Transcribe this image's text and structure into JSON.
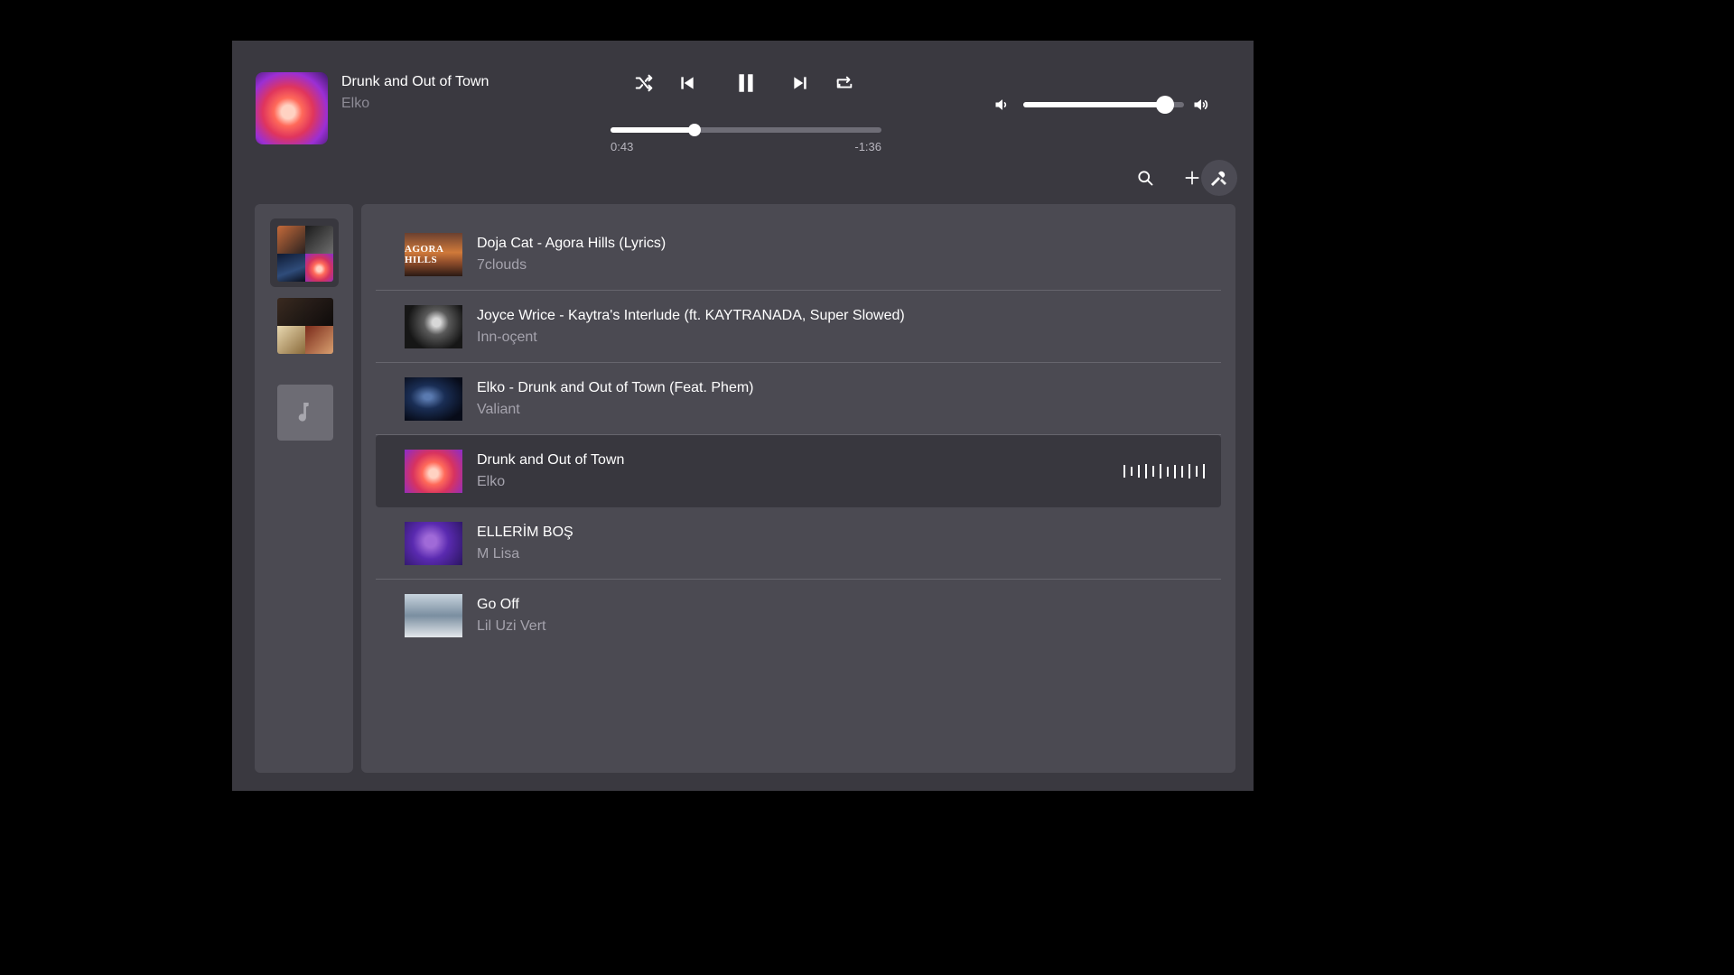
{
  "now_playing": {
    "title": "Drunk and Out of Town",
    "artist": "Elko",
    "elapsed": "0:43",
    "remaining": "-1:36",
    "progress": 0.31,
    "is_playing": true
  },
  "volume": {
    "level": 0.88
  },
  "controls": [
    "shuffle-icon",
    "previous-icon",
    "pause-icon",
    "next-icon",
    "repeat-icon"
  ],
  "toolbar": [
    "search-icon",
    "plus-icon",
    "tools-icon"
  ],
  "sidebar": {
    "playlists": [
      {
        "kind": "mosaic",
        "active": true
      },
      {
        "kind": "mosaic",
        "active": false
      },
      {
        "kind": "empty",
        "icon": "music-note-icon",
        "active": false
      }
    ]
  },
  "tracks": [
    {
      "title": "Doja Cat - Agora Hills (Lyrics)",
      "artist": "7clouds",
      "thumb_text": "AGORA HILLS",
      "playing": false
    },
    {
      "title": "Joyce Wrice - Kaytra's Interlude (ft. KAYTRANADA, Super Slowed)",
      "artist": "Inn-oçent",
      "thumb_text": "",
      "playing": false
    },
    {
      "title": "Elko - Drunk and Out of Town (Feat. Phem)",
      "artist": "Valiant",
      "thumb_text": "",
      "playing": false
    },
    {
      "title": "Drunk and Out of Town",
      "artist": "Elko",
      "thumb_text": "",
      "playing": true
    },
    {
      "title": "ELLERİM BOŞ",
      "artist": "M Lisa",
      "thumb_text": "",
      "playing": false
    },
    {
      "title": "Go Off",
      "artist": "Lil Uzi Vert",
      "thumb_text": "",
      "playing": false
    }
  ],
  "colors": {
    "window_bg": "#3a3940",
    "panel_bg": "#4b4a52",
    "active_row_bg": "#38373e",
    "secondary_text": "#a5a3ad",
    "accent": "#ffffff"
  }
}
